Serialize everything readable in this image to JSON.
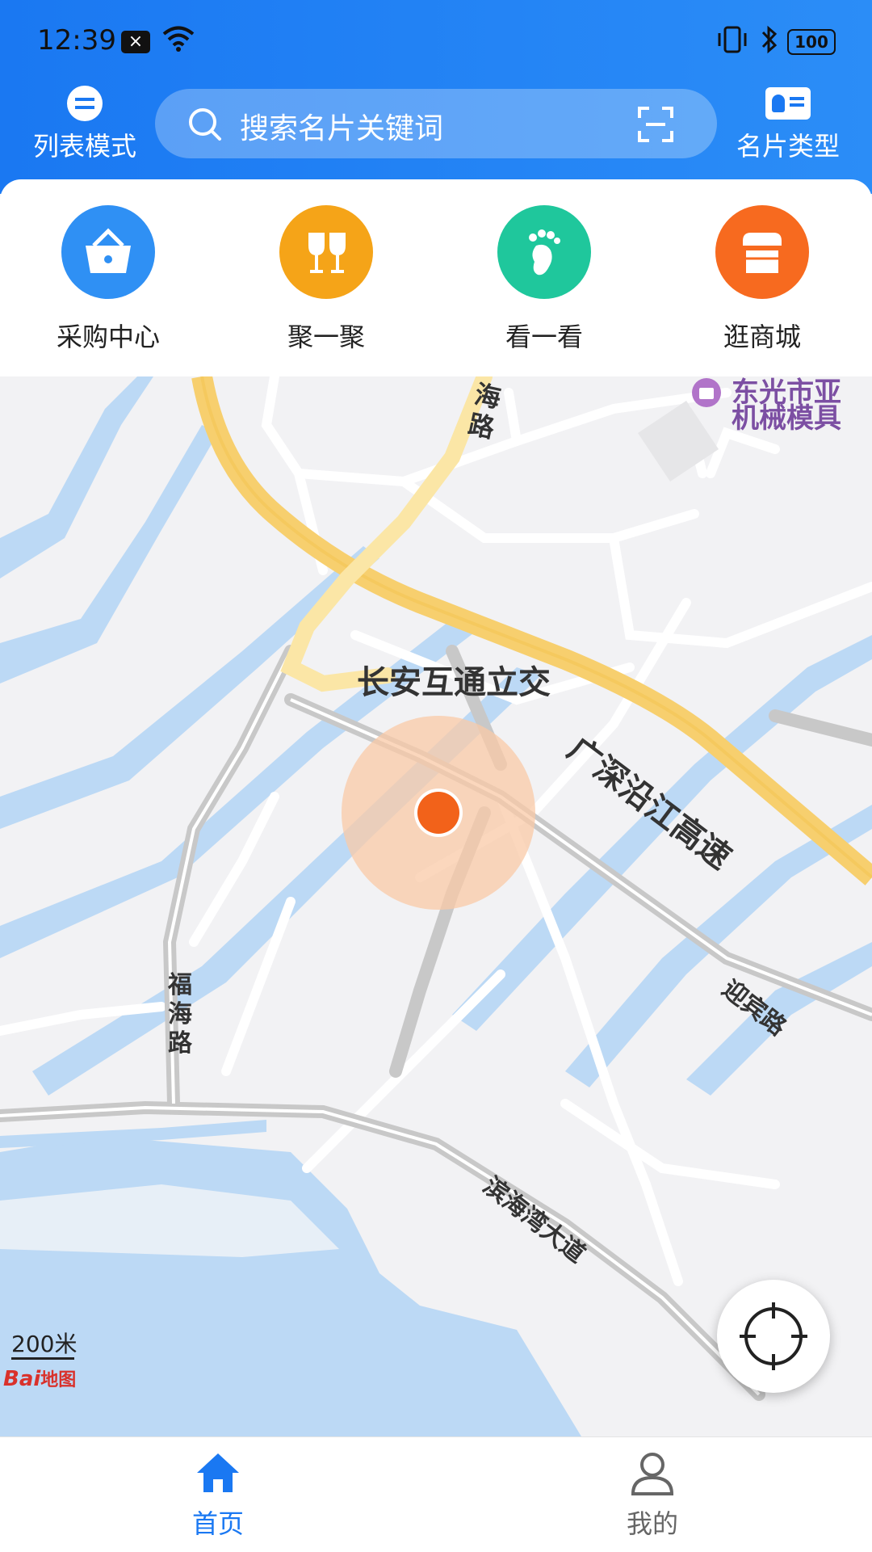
{
  "status_bar": {
    "time": "12:39",
    "notif_badge": "×",
    "battery": "100"
  },
  "header": {
    "list_mode_label": "列表模式",
    "search_placeholder": "搜索名片关键词",
    "card_type_label": "名片类型"
  },
  "categories": [
    {
      "label": "采购中心",
      "icon": "basket-icon",
      "color": "#2f90f4"
    },
    {
      "label": "聚一聚",
      "icon": "wine-glasses-icon",
      "color": "#f5a418"
    },
    {
      "label": "看一看",
      "icon": "footprint-icon",
      "color": "#1fc79c"
    },
    {
      "label": "逛商城",
      "icon": "store-icon",
      "color": "#f76a1f"
    }
  ],
  "map": {
    "labels": {
      "interchange": "长安互通立交",
      "expressway": "广深沿江高速",
      "fuhai_road": "福海路",
      "haiyan_road_top": "海路",
      "yingbin_road": "迎宾路",
      "binhaiwan_avenue": "滨海湾大道",
      "poi_partial_1": "东光市亚",
      "poi_partial_2": "机械模具"
    },
    "scale": "200米",
    "provider": "Bai",
    "provider_suffix": "地图"
  },
  "tabbar": [
    {
      "label": "首页",
      "icon": "home-icon",
      "active": true
    },
    {
      "label": "我的",
      "icon": "user-icon",
      "active": false
    }
  ],
  "colors": {
    "primary": "#1a78f2",
    "water": "#bcd9f5",
    "highway": "#f7cf6e",
    "marker": "#f2621a",
    "inactive": "#666666"
  }
}
